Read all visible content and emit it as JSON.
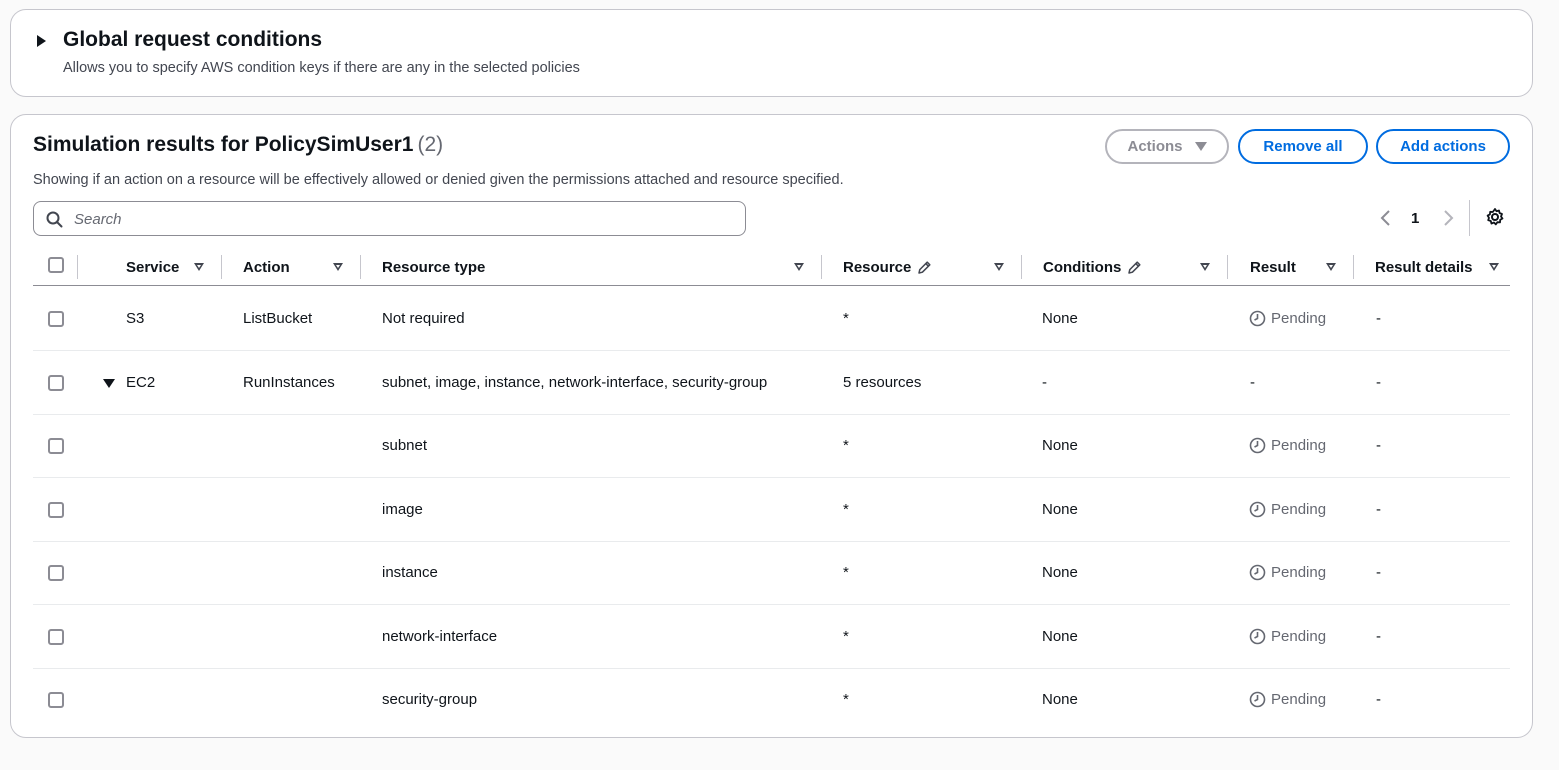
{
  "global_conditions": {
    "title": "Global request conditions",
    "description": "Allows you to specify AWS condition keys if there are any in the selected policies"
  },
  "results": {
    "title": "Simulation results for PolicySimUser1",
    "count": "(2)",
    "description": "Showing if an action on a resource will be effectively allowed or denied given the permissions attached and resource specified.",
    "buttons": {
      "actions": "Actions",
      "remove_all": "Remove all",
      "add_actions": "Add actions"
    },
    "search_placeholder": "Search",
    "page": "1",
    "columns": {
      "service": "Service",
      "action": "Action",
      "resource_type": "Resource type",
      "resource": "Resource",
      "conditions": "Conditions",
      "result": "Result",
      "result_details": "Result details"
    },
    "rows": [
      {
        "service": "S3",
        "action": "ListBucket",
        "resource_type": "Not required",
        "resource": "*",
        "conditions": "None",
        "result": "Pending",
        "result_details": "-"
      },
      {
        "service": "EC2",
        "action": "RunInstances",
        "resource_type": "subnet, image, instance, network-interface, security-group",
        "resource": "5 resources",
        "conditions": "-",
        "result": "-",
        "result_details": "-"
      },
      {
        "service": "",
        "action": "",
        "resource_type": "subnet",
        "resource": "*",
        "conditions": "None",
        "result": "Pending",
        "result_details": "-"
      },
      {
        "service": "",
        "action": "",
        "resource_type": "image",
        "resource": "*",
        "conditions": "None",
        "result": "Pending",
        "result_details": "-"
      },
      {
        "service": "",
        "action": "",
        "resource_type": "instance",
        "resource": "*",
        "conditions": "None",
        "result": "Pending",
        "result_details": "-"
      },
      {
        "service": "",
        "action": "",
        "resource_type": "network-interface",
        "resource": "*",
        "conditions": "None",
        "result": "Pending",
        "result_details": "-"
      },
      {
        "service": "",
        "action": "",
        "resource_type": "security-group",
        "resource": "*",
        "conditions": "None",
        "result": "Pending",
        "result_details": "-"
      }
    ]
  },
  "icons": {
    "expand": "caret-right-icon",
    "collapse": "caret-down-icon",
    "search": "search-icon",
    "prev": "chevron-left-icon",
    "next": "chevron-right-icon",
    "settings": "gear-icon",
    "edit": "pencil-icon",
    "pending": "clock-icon",
    "sort": "sort-icon"
  },
  "colors": {
    "accent": "#006ce0",
    "text": "#0f141a",
    "muted": "#656871",
    "border": "#c6c6cd"
  }
}
